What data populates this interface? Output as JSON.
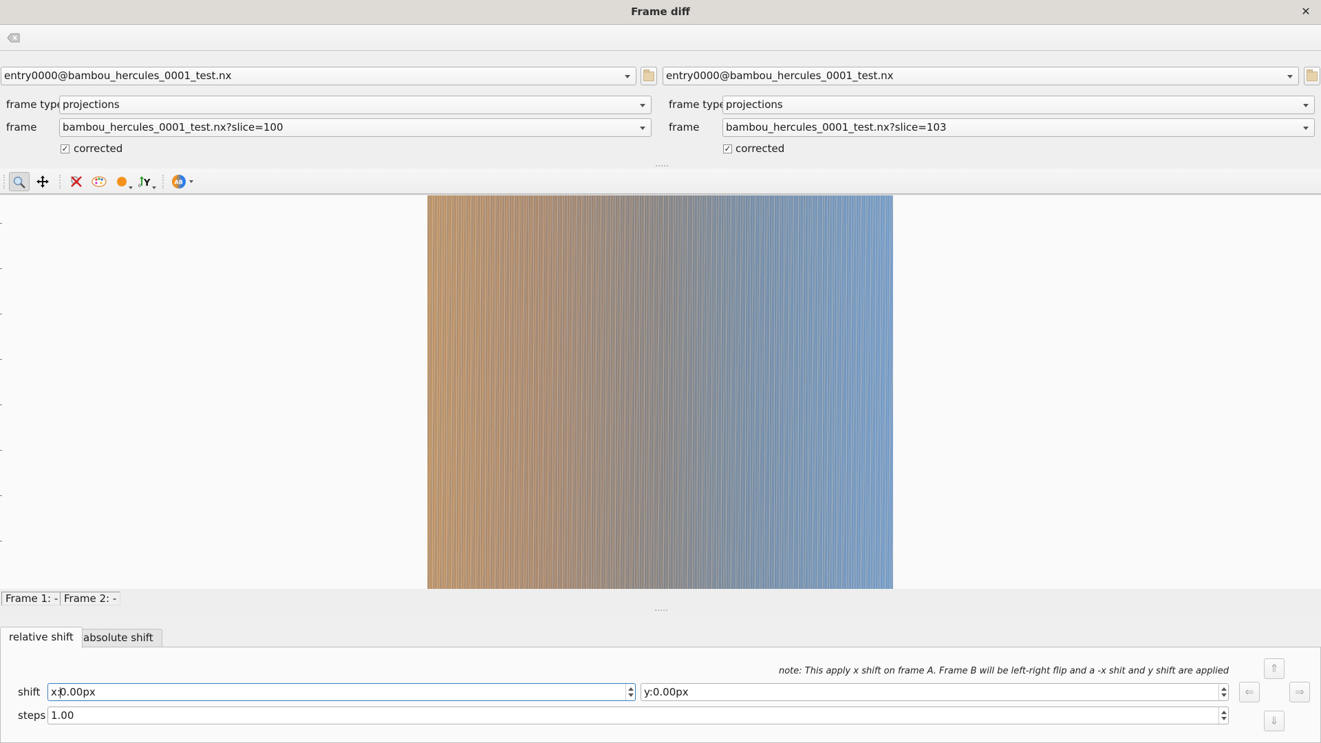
{
  "window": {
    "title": "Frame diff",
    "close_icon": "close-icon"
  },
  "topbar": {
    "clear_icon": "clear-backspace-icon"
  },
  "frame_a": {
    "scan": "entry0000@bambou_hercules_0001_test.nx",
    "frame_type_label": "frame type",
    "frame_type": "projections",
    "frame_label": "frame",
    "frame": "bambou_hercules_0001_test.nx?slice=100",
    "corrected_label": "corrected",
    "corrected": true
  },
  "frame_b": {
    "scan": "entry0000@bambou_hercules_0001_test.nx",
    "frame_type_label": "frame type",
    "frame_type": "projections",
    "frame_label": "frame",
    "frame": "bambou_hercules_0001_test.nx?slice=103",
    "corrected_label": "corrected",
    "corrected": true
  },
  "toolbar": {
    "tools": [
      {
        "name": "zoom-mode",
        "icon": "magnifier-icon",
        "active": true
      },
      {
        "name": "pan-mode",
        "icon": "pan-arrows-icon",
        "active": false
      },
      {
        "name": "reset-zoom",
        "icon": "reset-zoom-icon",
        "active": false
      },
      {
        "name": "colormap",
        "icon": "palette-icon",
        "active": false
      },
      {
        "name": "background-color",
        "icon": "orange-circle-icon",
        "active": false
      },
      {
        "name": "y-axis-origin",
        "icon": "y-axis-icon",
        "active": false
      },
      {
        "name": "composite-mode",
        "icon": "ab-composite-icon",
        "active": false
      }
    ],
    "composite_label": "AB"
  },
  "status": {
    "frame1": "Frame 1: -",
    "frame2": "Frame 2: -"
  },
  "tabs": [
    {
      "label": "relative shift",
      "active": true
    },
    {
      "label": "absolute shift",
      "active": false
    }
  ],
  "relative_shift": {
    "note": "note: This apply x shift on frame A. Frame B will be left-right flip and a -x shit and y shift are applied",
    "shift_label": "shift",
    "shift_x": "x:0.00px",
    "shift_x_prefix": "x:",
    "shift_x_value": "0.00px",
    "shift_y": "y:0.00px",
    "steps_label": "steps",
    "steps": "1.00",
    "arrows": [
      "up",
      "left",
      "right",
      "down"
    ]
  },
  "colors": {
    "accent_focus": "#3c7dbd",
    "frame_a_tint": "#c49a6e",
    "frame_b_tint": "#7ea4cf"
  }
}
